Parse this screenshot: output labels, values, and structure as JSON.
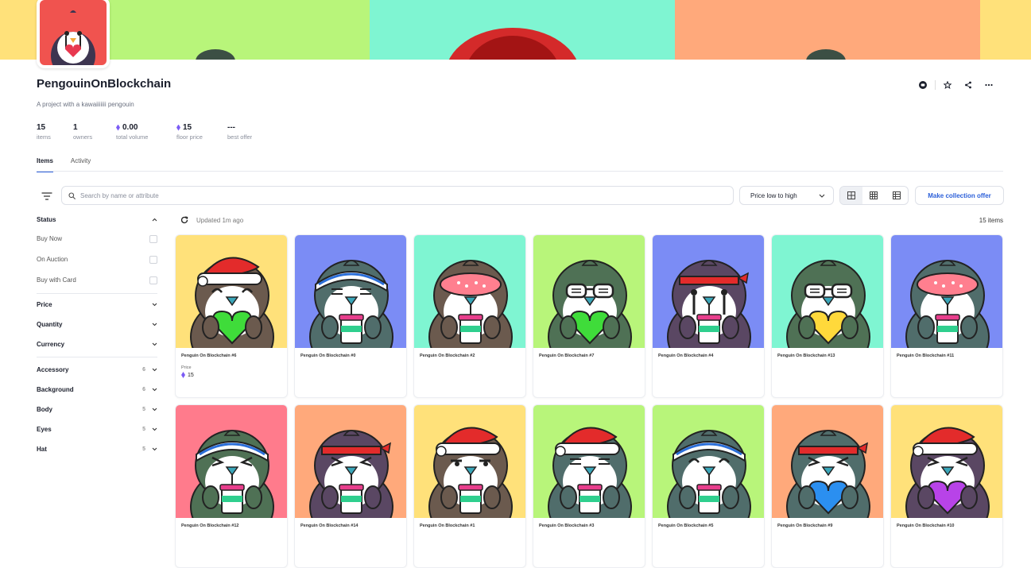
{
  "collection": {
    "title": "PengouinOnBlockchain",
    "description": "A project with a kawaiiiiiii pengouin"
  },
  "stats": [
    {
      "value": "15",
      "label": "items",
      "eth": false
    },
    {
      "value": "1",
      "label": "owners",
      "eth": false
    },
    {
      "value": "0.00",
      "label": "total volume",
      "eth": true
    },
    {
      "value": "15",
      "label": "floor price",
      "eth": true
    },
    {
      "value": "---",
      "label": "best offer",
      "eth": false
    }
  ],
  "tabs": [
    "Items",
    "Activity"
  ],
  "search": {
    "placeholder": "Search by name or attribute"
  },
  "sort": {
    "selected": "Price low to high"
  },
  "offer_button": "Make collection offer",
  "updated": "Updated 1m ago",
  "items_count": "15 items",
  "sidebar": {
    "status": {
      "label": "Status",
      "options": [
        "Buy Now",
        "On Auction",
        "Buy with Card"
      ]
    },
    "filters": [
      "Price",
      "Quantity",
      "Currency"
    ],
    "traits": [
      {
        "label": "Accessory",
        "count": "6"
      },
      {
        "label": "Background",
        "count": "6"
      },
      {
        "label": "Body",
        "count": "5"
      },
      {
        "label": "Eyes",
        "count": "5"
      },
      {
        "label": "Hat",
        "count": "5"
      }
    ]
  },
  "price_label": "Price",
  "items": [
    {
      "name": "Penguin On Blockchain #6",
      "bg": "#ffe17a",
      "body": "#6b5a4e",
      "hat": "santa",
      "hold": "heart-green",
      "eyes": "happy",
      "price": "15"
    },
    {
      "name": "Penguin On Blockchain #0",
      "bg": "#7b8cf5",
      "body": "#506d6b",
      "hat": "headband-blue",
      "hold": "cup",
      "eyes": "line"
    },
    {
      "name": "Penguin On Blockchain #2",
      "bg": "#7ff5d2",
      "body": "#6b5a4e",
      "hat": "mask",
      "hold": "cup",
      "eyes": "none"
    },
    {
      "name": "Penguin On Blockchain #7",
      "bg": "#b8f57a",
      "body": "#4f7155",
      "hat": "glasses",
      "hold": "heart-green",
      "eyes": "glasses"
    },
    {
      "name": "Penguin On Blockchain #4",
      "bg": "#7b8cf5",
      "body": "#5a4763",
      "hat": "headband-red",
      "hold": "cup",
      "eyes": "cry"
    },
    {
      "name": "Penguin On Blockchain #13",
      "bg": "#7ff5d2",
      "body": "#4f7155",
      "hat": "glasses",
      "hold": "heart-yellow",
      "eyes": "glasses"
    },
    {
      "name": "Penguin On Blockchain #11",
      "bg": "#7b8cf5",
      "body": "#506d6b",
      "hat": "mask",
      "hold": "cup",
      "eyes": "none"
    },
    {
      "name": "Penguin On Blockchain #12",
      "bg": "#ff7b8c",
      "body": "#4f7155",
      "hat": "headband-blue",
      "hold": "cup",
      "eyes": "angry"
    },
    {
      "name": "Penguin On Blockchain #14",
      "bg": "#ffa97b",
      "body": "#5a4763",
      "hat": "headband-red",
      "hold": "cup",
      "eyes": "angry"
    },
    {
      "name": "Penguin On Blockchain #1",
      "bg": "#ffe17a",
      "body": "#6b5a4e",
      "hat": "santa",
      "hold": "cup",
      "eyes": "bored"
    },
    {
      "name": "Penguin On Blockchain #3",
      "bg": "#b8f57a",
      "body": "#506d6b",
      "hat": "santa",
      "hold": "cup",
      "eyes": "line"
    },
    {
      "name": "Penguin On Blockchain #5",
      "bg": "#b8f57a",
      "body": "#506d6b",
      "hat": "headband-blue",
      "hold": "cup",
      "eyes": "happy"
    },
    {
      "name": "Penguin On Blockchain #9",
      "bg": "#ffa97b",
      "body": "#506d6b",
      "hat": "headband-red",
      "hold": "heart-blue",
      "eyes": "angry"
    },
    {
      "name": "Penguin On Blockchain #10",
      "bg": "#ffe17a",
      "body": "#5a4763",
      "hat": "santa",
      "hold": "heart-purple",
      "eyes": "angry"
    }
  ],
  "banner_colors": [
    "#ffe17a",
    "#b8f57a",
    "#7ff5d2",
    "#ffa97b",
    "#ffe17a"
  ],
  "avatar_bg": "#f0534f"
}
